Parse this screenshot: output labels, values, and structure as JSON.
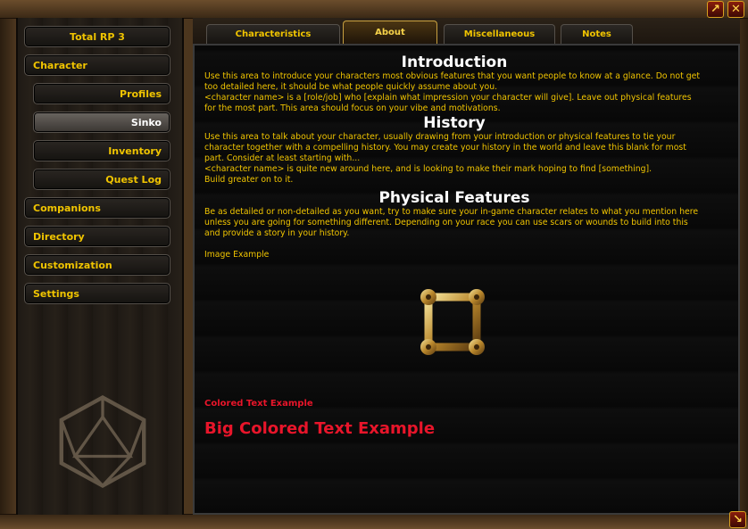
{
  "window": {
    "maximize_icon": "expand-arrow-icon",
    "close_icon": "close-x-icon",
    "resize_icon": "resize-arrow-icon"
  },
  "sidebar": {
    "title": "Total RP 3",
    "items": [
      {
        "label": "Character"
      },
      {
        "label": "Profiles"
      },
      {
        "label": "Sinko"
      },
      {
        "label": "Inventory"
      },
      {
        "label": "Quest Log"
      },
      {
        "label": "Companions"
      },
      {
        "label": "Directory"
      },
      {
        "label": "Customization"
      },
      {
        "label": "Settings"
      }
    ]
  },
  "tabs": [
    {
      "label": "Characteristics"
    },
    {
      "label": "About"
    },
    {
      "label": "Miscellaneous"
    },
    {
      "label": "Notes"
    }
  ],
  "content": {
    "intro_heading": "Introduction",
    "intro_p1": "Use this area to introduce your characters most obvious features that you want people to know at a glance. Do not get too detailed here, it should be what people quickly assume about you.",
    "intro_p2": "<character name> is a [role/job] who [explain what impression your character will give]. Leave out physical features for the most part. This area should focus on your vibe and motivations.",
    "history_heading": "History",
    "history_p1": "Use this area to talk about your character, usually drawing from your introduction or physical features to tie your character together with a compelling history. You may create your history in the world and leave this blank for most part. Consider at least starting with...",
    "history_p2": "<character name> is quite new around here, and is looking to make their mark hoping to find [something].",
    "history_p3": "Build greater on to it.",
    "physical_heading": "Physical Features",
    "physical_p1": "Be as detailed or non-detailed as you want, try to make sure your in-game character relates to what you mention here unless you are going for something different. Depending on your race you can use scars or wounds to build into this and provide a story in your history.",
    "image_label": "Image Example",
    "colored_text": "Colored Text Example",
    "big_colored_text": "Big Colored Text Example"
  },
  "colors": {
    "gold_text": "#f0c400",
    "red_text": "#e8152a",
    "heading_text": "#ffffff"
  }
}
